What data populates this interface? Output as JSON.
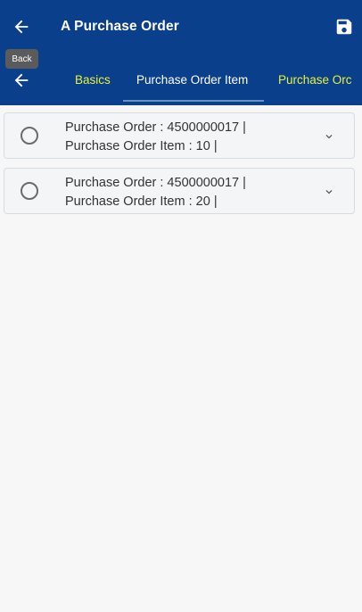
{
  "header": {
    "title": "A Purchase Order",
    "back_icon": "arrow-left-icon",
    "save_icon": "floppy-disk-icon",
    "tooltip": "Back"
  },
  "tabs": [
    {
      "label": "Basics",
      "active": false
    },
    {
      "label": "Purchase Order Item",
      "active": true
    },
    {
      "label": "Purchase Orc",
      "active": false
    }
  ],
  "items": [
    {
      "line1": "Purchase Order : 4500000017 |",
      "line2": "Purchase Order Item : 10 |"
    },
    {
      "line1": "Purchase Order : 4500000017 |",
      "line2": "Purchase Order Item : 20 |"
    }
  ],
  "colors": {
    "appbar": "#0a3f8c",
    "tab_inactive": "#e6f23a",
    "tab_active": "#ffffff"
  }
}
